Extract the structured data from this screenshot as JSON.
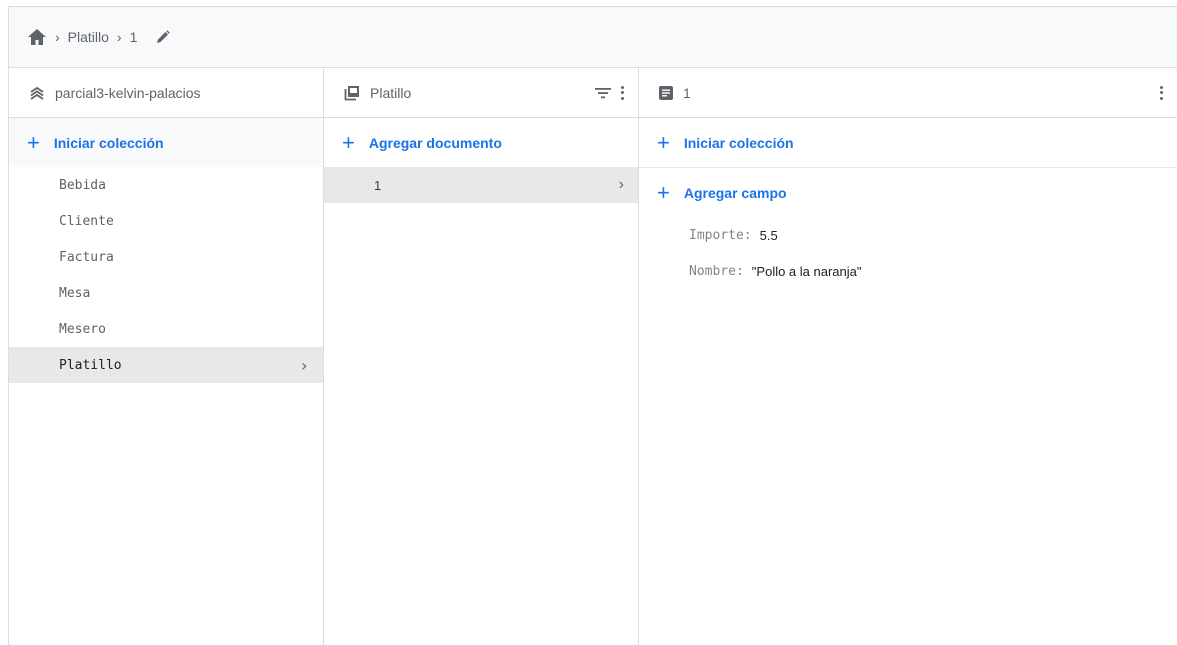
{
  "breadcrumb": {
    "items": [
      "Platillo",
      "1"
    ]
  },
  "columns": {
    "root": {
      "title": "parcial3-kelvin-palacios",
      "action_label": "Iniciar colección",
      "collections": [
        "Bebida",
        "Cliente",
        "Factura",
        "Mesa",
        "Mesero",
        "Platillo"
      ],
      "selected": "Platillo"
    },
    "collection": {
      "title": "Platillo",
      "action_label": "Agregar documento",
      "documents": [
        "1"
      ],
      "selected": "1"
    },
    "document": {
      "title": "1",
      "action_collection_label": "Iniciar colección",
      "action_field_label": "Agregar campo",
      "fields": [
        {
          "key": "Importe:",
          "value": "5.5"
        },
        {
          "key": "Nombre:",
          "value": "\"Pollo a la naranja\""
        }
      ]
    }
  },
  "colors": {
    "accent": "#1a73e8",
    "selected_bg": "#e8e8e8",
    "border": "#dadce0"
  }
}
